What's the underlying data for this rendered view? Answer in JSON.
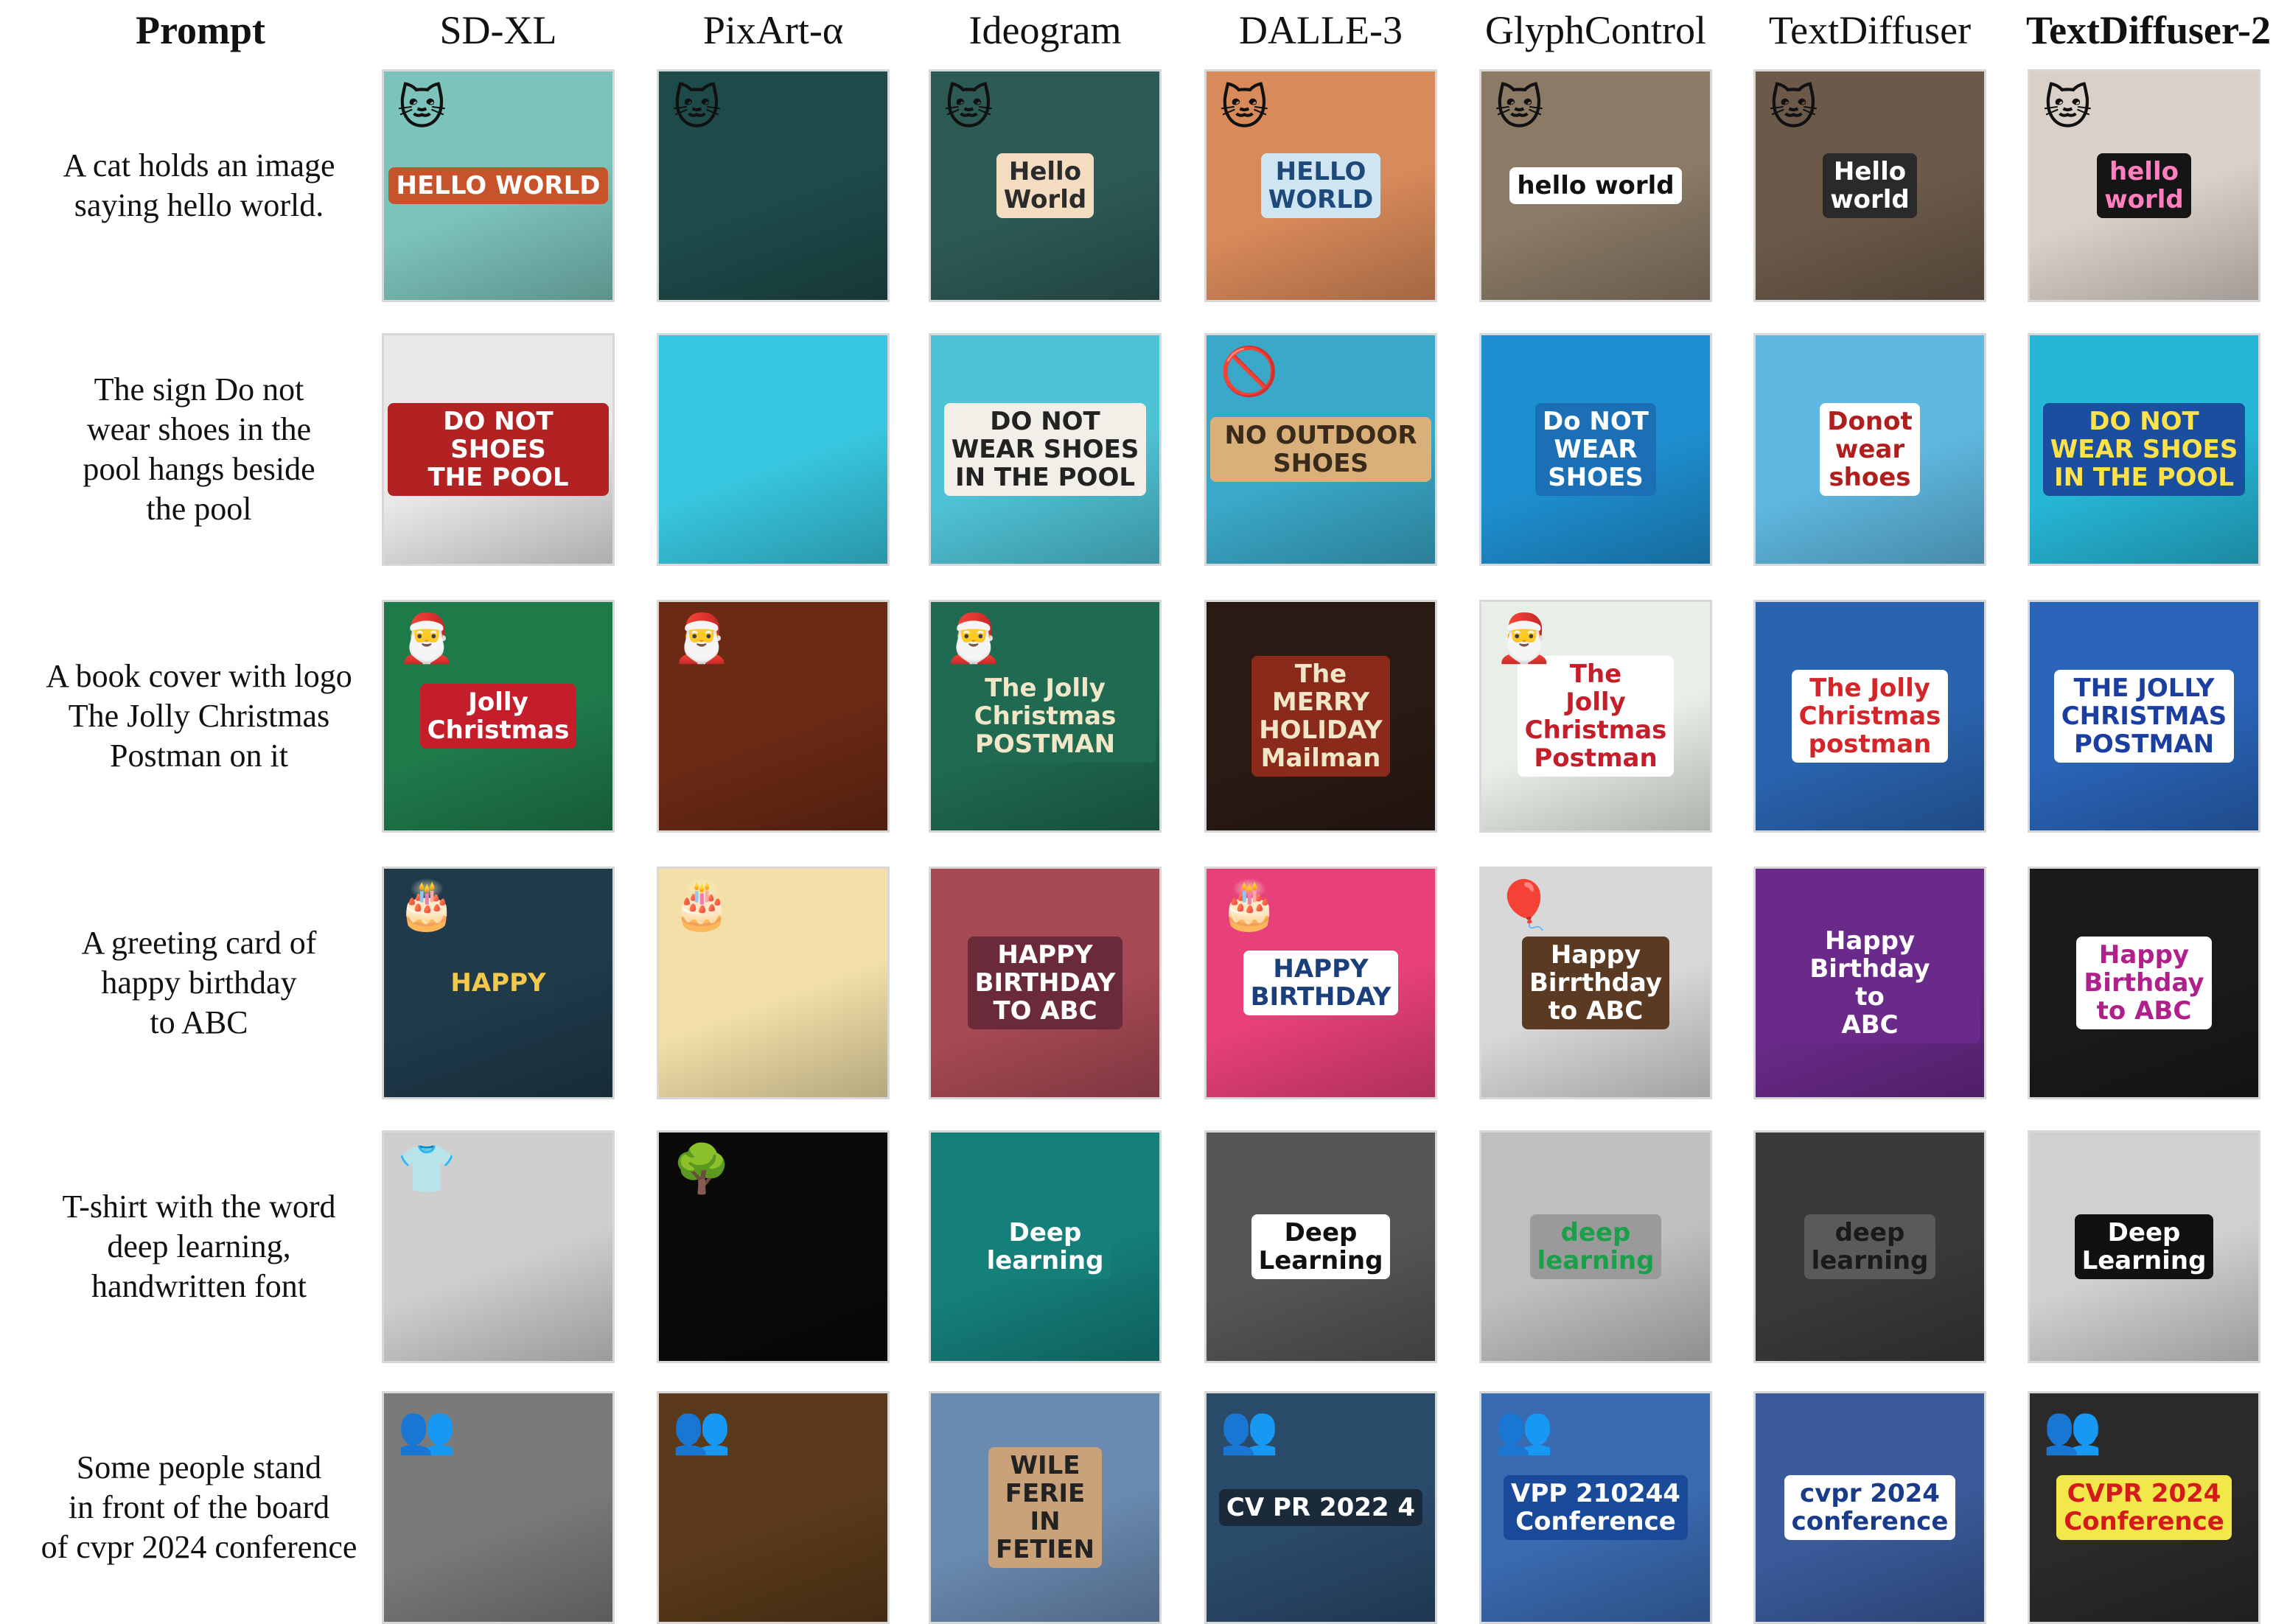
{
  "columns": [
    {
      "label": "Prompt",
      "bold": true
    },
    {
      "label": "SD-XL",
      "bold": false
    },
    {
      "label": "PixArt-α",
      "bold": false
    },
    {
      "label": "Ideogram",
      "bold": false
    },
    {
      "label": "DALLE-3",
      "bold": false
    },
    {
      "label": "GlyphControl",
      "bold": false
    },
    {
      "label": "TextDiffuser",
      "bold": false
    },
    {
      "label": "TextDiffuser-2",
      "bold": true
    }
  ],
  "rows": [
    {
      "prompt": [
        "A cat holds an image",
        "saying hello world."
      ],
      "images": [
        {
          "bg": "#7cc3bb",
          "fg": "#ffffff",
          "textbg": "#c7532b",
          "text": "HELLO WORLD",
          "icon": "🐱"
        },
        {
          "bg": "#1e4a4a",
          "fg": "#6b5a3a",
          "textbg": "#d9c79a",
          "text": "",
          "icon": "🐱"
        },
        {
          "bg": "#2d5a55",
          "fg": "#2b2b2b",
          "textbg": "#f3dcc0",
          "text": "Hello\nWorld",
          "icon": "🐱"
        },
        {
          "bg": "#d98a5a",
          "fg": "#1d4a7a",
          "textbg": "#cfe6f2",
          "text": "HELLO\nWORLD",
          "icon": "🐱"
        },
        {
          "bg": "#8a7a66",
          "fg": "#111111",
          "textbg": "#ffffff",
          "text": "hello world",
          "icon": "🐱"
        },
        {
          "bg": "#6b5a4a",
          "fg": "#ffffff",
          "textbg": "#2a2a2a",
          "text": "Hello\nworld",
          "icon": "🐱"
        },
        {
          "bg": "#d9d0c8",
          "fg": "#ff7fbf",
          "textbg": "#151515",
          "text": "hello\nworld",
          "icon": "🐱"
        }
      ]
    },
    {
      "prompt": [
        "The sign Do not",
        "wear shoes in the",
        "pool hangs beside",
        "the pool"
      ],
      "images": [
        {
          "bg": "#e8e8e8",
          "fg": "#ffffff",
          "textbg": "#b22222",
          "text": "DO NOT SHOES\nTHE POOL",
          "icon": ""
        },
        {
          "bg": "#38c7e0",
          "fg": "#777777",
          "textbg": "#f2f2f2",
          "text": "",
          "icon": ""
        },
        {
          "bg": "#4fc3d6",
          "fg": "#222222",
          "textbg": "#f2efe8",
          "text": "DO NOT\nWEAR SHOES\nIN THE POOL",
          "icon": ""
        },
        {
          "bg": "#3aa9c9",
          "fg": "#3a2a1a",
          "textbg": "#d9b07a",
          "text": "NO OUTDOOR SHOES",
          "icon": "🚫"
        },
        {
          "bg": "#1e8fd0",
          "fg": "#ffffff",
          "textbg": "#1a6fb5",
          "text": "Do NOT\nWEAR\nSHOES",
          "icon": ""
        },
        {
          "bg": "#5fb8e0",
          "fg": "#b01e1e",
          "textbg": "#ffffff",
          "text": "Donot\nwear\nshoes",
          "icon": ""
        },
        {
          "bg": "#26b6d6",
          "fg": "#ffe14a",
          "textbg": "#1a4fa0",
          "text": "DO NOT\nWEAR SHOES\nIN THE POOL",
          "icon": ""
        }
      ]
    },
    {
      "prompt": [
        "A book cover with logo",
        "The Jolly Christmas",
        "Postman on it"
      ],
      "images": [
        {
          "bg": "#1f7a4a",
          "fg": "#ffffff",
          "textbg": "#c41e2a",
          "text": "Jolly\nChristmas",
          "icon": "🎅"
        },
        {
          "bg": "#6b2a14",
          "fg": "#ffffff",
          "textbg": "#b5451b",
          "text": "",
          "icon": "🎅"
        },
        {
          "bg": "#1f6a50",
          "fg": "#f2e6c8",
          "textbg": "#1f6a50",
          "text": "The Jolly Christmas\nPOSTMAN",
          "icon": "🎅"
        },
        {
          "bg": "#2a1a14",
          "fg": "#f2e6c8",
          "textbg": "#8a2a1a",
          "text": "The\nMERRY\nHOLIDAY\nMailman",
          "icon": ""
        },
        {
          "bg": "#e8efe6",
          "fg": "#c41e2a",
          "textbg": "#ffffff",
          "text": "The\nJolly\nChristmas\nPostman",
          "icon": "🎅"
        },
        {
          "bg": "#2a64b0",
          "fg": "#d3262a",
          "textbg": "#ffffff",
          "text": "The Jolly\nChristmas\npostman",
          "icon": ""
        },
        {
          "bg": "#2a64b8",
          "fg": "#1a3fa0",
          "textbg": "#ffffff",
          "text": "THE JOLLY\nCHRISTMAS\nPOSTMAN",
          "icon": ""
        }
      ]
    },
    {
      "prompt": [
        "A greeting card of",
        "happy birthday",
        "to ABC"
      ],
      "images": [
        {
          "bg": "#1f3a4a",
          "fg": "#f2c94c",
          "textbg": "#1f3a4a",
          "text": "HAPPY",
          "icon": "🎂"
        },
        {
          "bg": "#f2e0a8",
          "fg": "#ffffff",
          "textbg": "#f2e0a8",
          "text": "",
          "icon": "🎂"
        },
        {
          "bg": "#a84a55",
          "fg": "#ffffff",
          "textbg": "#6a2a3a",
          "text": "HAPPY\nBIRTHDAY\nTO ABC",
          "icon": ""
        },
        {
          "bg": "#e8407a",
          "fg": "#1a3f7a",
          "textbg": "#ffffff",
          "text": "HAPPY\nBIRTHDAY",
          "icon": "🎂"
        },
        {
          "bg": "#d8d8d8",
          "fg": "#ffffff",
          "textbg": "#5a3a22",
          "text": "Happy\nBirrthday\nto ABC",
          "icon": "🎈"
        },
        {
          "bg": "#6a2a8a",
          "fg": "#ffffff",
          "textbg": "#6a2a8a",
          "text": "Happy Birthday\nto\nABC",
          "icon": ""
        },
        {
          "bg": "#1a1a1a",
          "fg": "#b0208a",
          "textbg": "#ffffff",
          "text": "Happy\nBirthday\nto ABC",
          "icon": ""
        }
      ]
    },
    {
      "prompt": [
        "T-shirt with the word",
        "deep learning,",
        "handwritten font"
      ],
      "images": [
        {
          "bg": "#cfcfcf",
          "fg": "#444444",
          "textbg": "#f2f2f2",
          "text": "",
          "icon": "👕"
        },
        {
          "bg": "#0a0a0a",
          "fg": "#d98a3a",
          "textbg": "#0a0a0a",
          "text": "",
          "icon": "🌳"
        },
        {
          "bg": "#157f7a",
          "fg": "#ffffff",
          "textbg": "#157f7a",
          "text": "Deep\nlearning",
          "icon": ""
        },
        {
          "bg": "#555555",
          "fg": "#111111",
          "textbg": "#ffffff",
          "text": "Deep\nLearning",
          "icon": ""
        },
        {
          "bg": "#bfbfbf",
          "fg": "#1aa04a",
          "textbg": "#9a9a9a",
          "text": "deep\nlearning",
          "icon": ""
        },
        {
          "bg": "#3a3a3a",
          "fg": "#1a1a1a",
          "textbg": "#5a5a5a",
          "text": "deep\nlearning",
          "icon": ""
        },
        {
          "bg": "#d0d0d0",
          "fg": "#ffffff",
          "textbg": "#111111",
          "text": "Deep\nLearning",
          "icon": ""
        }
      ]
    },
    {
      "prompt": [
        "Some people stand",
        "in front of the board",
        "of cvpr 2024 conference"
      ],
      "images": [
        {
          "bg": "#7a7a7a",
          "fg": "#ffffff",
          "textbg": "#111111",
          "text": "",
          "icon": "👥"
        },
        {
          "bg": "#5a3a1a",
          "fg": "#f2c06a",
          "textbg": "#5a3a1a",
          "text": "",
          "icon": "👥"
        },
        {
          "bg": "#6a8ab0",
          "fg": "#222222",
          "textbg": "#c9a27a",
          "text": "WILE\nFERIE\nIN\nFETIEN",
          "icon": ""
        },
        {
          "bg": "#2a4a6a",
          "fg": "#ffffff",
          "textbg": "#1a2a3a",
          "text": "CV PR 2022 4",
          "icon": "👥"
        },
        {
          "bg": "#3a6ab0",
          "fg": "#ffffff",
          "textbg": "#1a4a9a",
          "text": "VPP 210244\nConference",
          "icon": "👥"
        },
        {
          "bg": "#3a5a9a",
          "fg": "#1a3a8a",
          "textbg": "#ffffff",
          "text": "cvpr 2024\nconference",
          "icon": ""
        },
        {
          "bg": "#2a2a2a",
          "fg": "#d41a1a",
          "textbg": "#f2e84a",
          "text": "CVPR 2024\nConference",
          "icon": "👥"
        }
      ]
    }
  ]
}
